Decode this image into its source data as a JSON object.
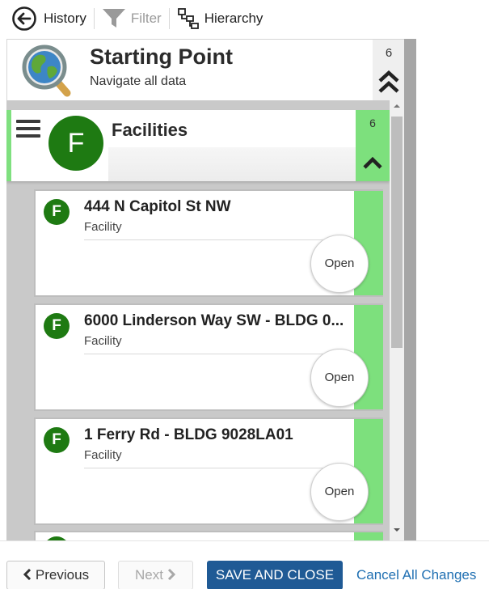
{
  "toolbar": {
    "history_label": "History",
    "filter_label": "Filter",
    "hierarchy_label": "Hierarchy"
  },
  "starting_point": {
    "title": "Starting Point",
    "subtitle": "Navigate all data",
    "count": "6"
  },
  "group": {
    "badge": "F",
    "title": "Facilities",
    "count": "6"
  },
  "items": [
    {
      "badge": "F",
      "title": "444 N Capitol St NW",
      "type": "Facility",
      "open_label": "Open"
    },
    {
      "badge": "F",
      "title": "6000 Linderson Way SW - BLDG 0...",
      "type": "Facility",
      "open_label": "Open"
    },
    {
      "badge": "F",
      "title": "1 Ferry Rd - BLDG 9028LA01",
      "type": "Facility",
      "open_label": "Open"
    }
  ],
  "footer": {
    "previous_label": "Previous",
    "next_label": "Next",
    "save_label": "SAVE AND CLOSE",
    "cancel_label": "Cancel All Changes"
  },
  "colors": {
    "accent_green": "#7de07d",
    "badge_green": "#1e7a12",
    "primary_blue": "#1f5a95",
    "link_blue": "#1f6fb2"
  }
}
